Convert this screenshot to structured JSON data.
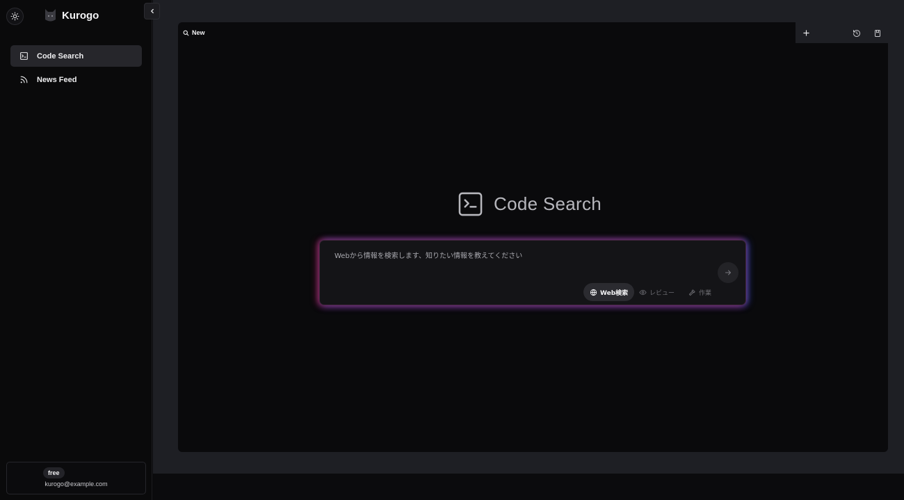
{
  "app": {
    "name": "Kurogo"
  },
  "sidebar": {
    "items": [
      {
        "label": "Code Search",
        "icon": "terminal-icon",
        "active": true
      },
      {
        "label": "News Feed",
        "icon": "rss-icon",
        "active": false
      }
    ],
    "account": {
      "plan": "free",
      "email": "kurogo@example.com"
    }
  },
  "tab": {
    "label": "New",
    "icon": "search-icon"
  },
  "toolbar": {
    "icons": [
      "plus-icon",
      "history-icon",
      "bookmark-icon"
    ]
  },
  "main": {
    "title": "Code Search",
    "title_icon": "terminal-icon",
    "prompt": {
      "placeholder": "Webから情報を検索します、知りたい情報を教えてください",
      "value": "",
      "modes": [
        {
          "label": "Web検索",
          "icon": "globe-icon",
          "active": true
        },
        {
          "label": "レビュー",
          "icon": "eye-icon",
          "active": false
        },
        {
          "label": "作業",
          "icon": "hammer-icon",
          "active": false
        }
      ]
    }
  },
  "colors": {
    "background": "#0a0a0c",
    "workspace": "#1e1f24",
    "active_nav": "#26262b",
    "glow_left": "#dc285a",
    "glow_right": "#3c6eff"
  }
}
